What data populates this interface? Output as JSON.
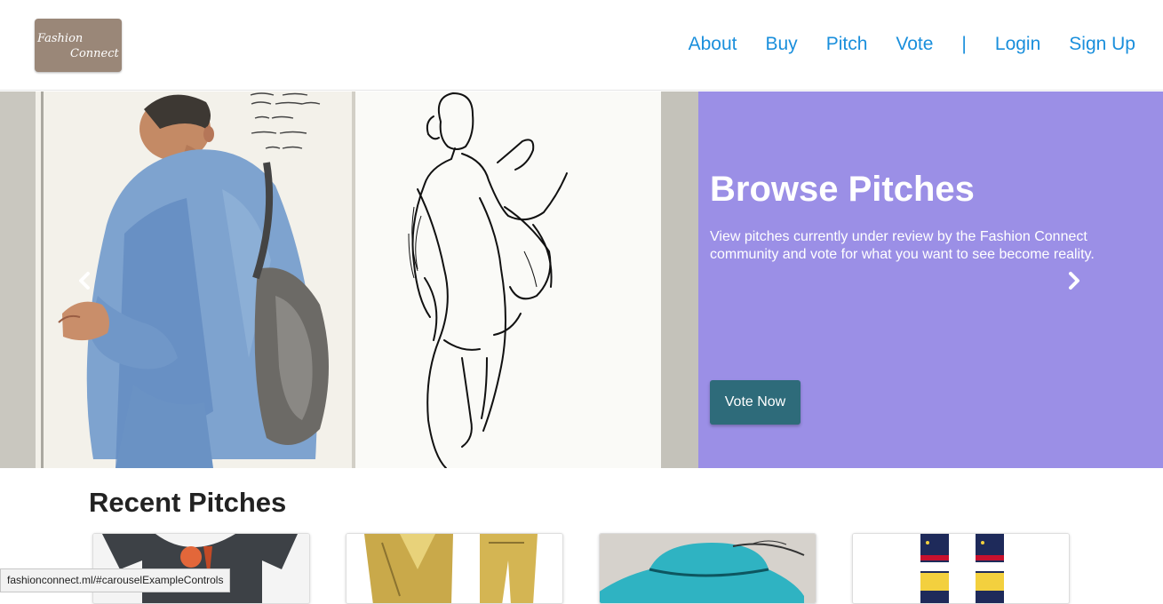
{
  "brand": {
    "logo_line1": "Fashion",
    "logo_line2": "Connect"
  },
  "nav": {
    "items": [
      {
        "label": "About"
      },
      {
        "label": "Buy"
      },
      {
        "label": "Pitch"
      },
      {
        "label": "Vote"
      },
      {
        "label": "|"
      },
      {
        "label": "Login"
      },
      {
        "label": "Sign Up"
      }
    ]
  },
  "hero": {
    "title": "Browse Pitches",
    "description": "View pitches currently under review by the Fashion Connect community and vote for what you want to see become reality.",
    "button_label": "Vote Now",
    "panel_color": "#9b8fe6",
    "button_color": "#2e6b7a",
    "sketch_note": "surface breaks up, color is absorbed quickly, can't blend."
  },
  "icons": {
    "prev": "chevron-left-icon",
    "next": "chevron-right-icon"
  },
  "recent": {
    "title": "Recent Pitches",
    "cards": [
      {
        "name": "t-shirt-pitch"
      },
      {
        "name": "gold-suit-pitch"
      },
      {
        "name": "teal-hat-pitch"
      },
      {
        "name": "socks-pitch"
      }
    ]
  },
  "status_bar": {
    "url": "fashionconnect.ml/#carouselExampleControls"
  },
  "colors": {
    "link": "#1a8fdc",
    "logo_bg": "#9a8778"
  }
}
